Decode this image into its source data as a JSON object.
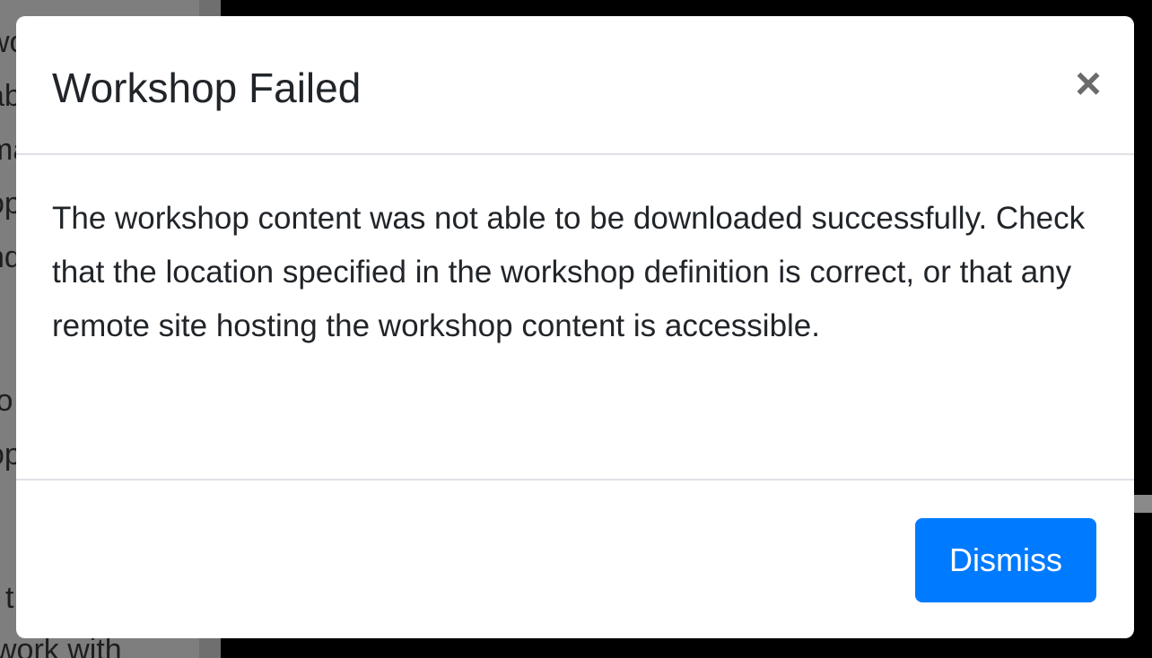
{
  "background": {
    "text_lines": [
      "wo",
      "ab",
      "ma",
      "op",
      "nd",
      "",
      "to",
      "op",
      "",
      "t",
      "work with"
    ]
  },
  "modal": {
    "title": "Workshop Failed",
    "close_icon": "×",
    "body": "The workshop content was not able to be downloaded successfully. Check that the location specified in the workshop definition is correct, or that any remote site hosting the workshop content is accessible.",
    "dismiss_label": "Dismiss"
  },
  "colors": {
    "primary": "#007bff",
    "title_text": "#212529",
    "close_icon": "#6b6b6b",
    "divider": "#dee2e6"
  }
}
